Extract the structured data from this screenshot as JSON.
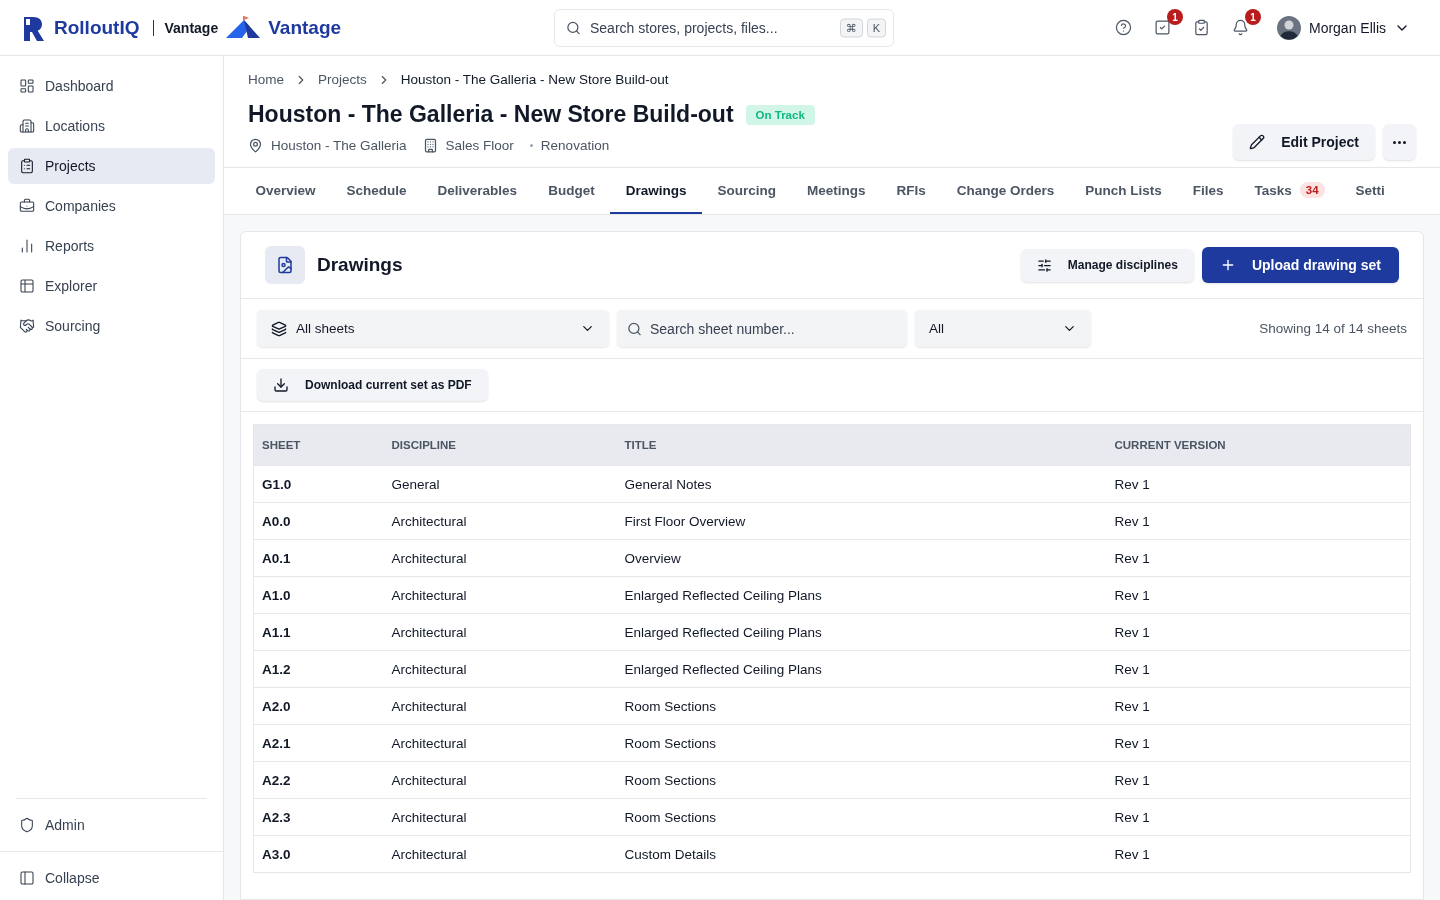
{
  "brand": {
    "logo_text": "RolloutIQ",
    "product": "Vantage",
    "product_logo_text": "Vantage"
  },
  "search": {
    "placeholder": "Search stores, projects, files...",
    "keys": [
      "⌘",
      "K"
    ]
  },
  "header_actions": [
    {
      "kind": "help"
    },
    {
      "kind": "tasks",
      "badge": "1"
    },
    {
      "kind": "clipboard"
    },
    {
      "kind": "bell",
      "badge": "1"
    }
  ],
  "user": {
    "name": "Morgan Ellis"
  },
  "sidebar": {
    "items": [
      {
        "kind": "dashboard",
        "label": "Dashboard",
        "selected": false
      },
      {
        "kind": "locations",
        "label": "Locations",
        "selected": false
      },
      {
        "kind": "projects",
        "label": "Projects",
        "selected": true
      },
      {
        "kind": "companies",
        "label": "Companies",
        "selected": false
      },
      {
        "kind": "reports",
        "label": "Reports",
        "selected": false
      },
      {
        "kind": "explorer",
        "label": "Explorer",
        "selected": false
      },
      {
        "kind": "sourcing",
        "label": "Sourcing",
        "selected": false
      }
    ],
    "bottom_items": [
      {
        "kind": "admin",
        "label": "Admin"
      },
      {
        "kind": "collapse",
        "label": "Collapse"
      }
    ]
  },
  "breadcrumbs": [
    "Home",
    "Projects",
    "Houston - The Galleria - New Store Build-out"
  ],
  "project": {
    "title": "Houston - The Galleria - New Store Build-out",
    "status": "On Track",
    "location": "Houston - The Galleria",
    "area": "Sales Floor",
    "type": "Renovation",
    "edit_button": "Edit Project"
  },
  "tabs": [
    {
      "label": "Overview",
      "selected": false
    },
    {
      "label": "Schedule",
      "selected": false
    },
    {
      "label": "Deliverables",
      "selected": false
    },
    {
      "label": "Budget",
      "selected": false
    },
    {
      "label": "Drawings",
      "selected": true
    },
    {
      "label": "Sourcing",
      "selected": false
    },
    {
      "label": "Meetings",
      "selected": false
    },
    {
      "label": "RFIs",
      "selected": false
    },
    {
      "label": "Change Orders",
      "selected": false
    },
    {
      "label": "Punch Lists",
      "selected": false
    },
    {
      "label": "Files",
      "selected": false
    },
    {
      "label": "Tasks",
      "selected": false,
      "count": "34"
    },
    {
      "label": "Setti",
      "selected": false
    }
  ],
  "drawings": {
    "title": "Drawings",
    "manage_button": "Manage disciplines",
    "upload_button": "Upload drawing set",
    "sheet_filter": "All sheets",
    "search_placeholder": "Search sheet number...",
    "discipline_filter": "All",
    "summary": "Showing 14 of 14 sheets",
    "download_button": "Download current set as PDF",
    "table": {
      "columns": [
        "SHEET",
        "DISCIPLINE",
        "TITLE",
        "CURRENT VERSION"
      ],
      "rows": [
        [
          "G1.0",
          "General",
          "General Notes",
          "Rev 1"
        ],
        [
          "A0.0",
          "Architectural",
          "First Floor Overview",
          "Rev 1"
        ],
        [
          "A0.1",
          "Architectural",
          "Overview",
          "Rev 1"
        ],
        [
          "A1.0",
          "Architectural",
          "Enlarged Reflected Ceiling Plans",
          "Rev 1"
        ],
        [
          "A1.1",
          "Architectural",
          "Enlarged Reflected Ceiling Plans",
          "Rev 1"
        ],
        [
          "A1.2",
          "Architectural",
          "Enlarged Reflected Ceiling Plans",
          "Rev 1"
        ],
        [
          "A2.0",
          "Architectural",
          "Room Sections",
          "Rev 1"
        ],
        [
          "A2.1",
          "Architectural",
          "Room Sections",
          "Rev 1"
        ],
        [
          "A2.2",
          "Architectural",
          "Room Sections",
          "Rev 1"
        ],
        [
          "A2.3",
          "Architectural",
          "Room Sections",
          "Rev 1"
        ],
        [
          "A3.0",
          "Architectural",
          "Custom Details",
          "Rev 1"
        ]
      ]
    }
  }
}
